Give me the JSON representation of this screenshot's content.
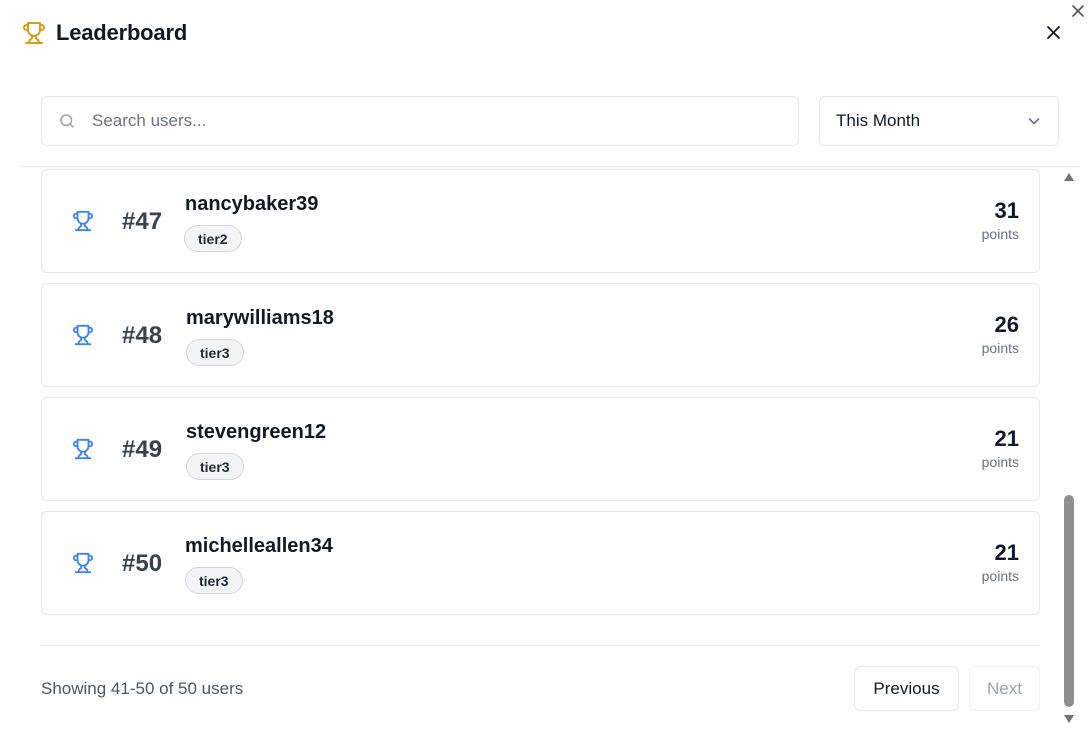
{
  "header": {
    "title": "Leaderboard"
  },
  "search": {
    "placeholder": "Search users..."
  },
  "period_select": {
    "value": "This Month"
  },
  "entries": [
    {
      "rank": "#47",
      "username": "nancybaker39",
      "tier": "tier2",
      "points": "31",
      "points_label": "points"
    },
    {
      "rank": "#48",
      "username": "marywilliams18",
      "tier": "tier3",
      "points": "26",
      "points_label": "points"
    },
    {
      "rank": "#49",
      "username": "stevengreen12",
      "tier": "tier3",
      "points": "21",
      "points_label": "points"
    },
    {
      "rank": "#50",
      "username": "michelleallen34",
      "tier": "tier3",
      "points": "21",
      "points_label": "points"
    }
  ],
  "pagination": {
    "summary": "Showing 41-50 of 50 users",
    "previous_label": "Previous",
    "next_label": "Next"
  },
  "colors": {
    "header_trophy": "#d4a017",
    "row_trophy": "#3b82f6",
    "border": "#e5e7eb"
  },
  "icons": {
    "header": "trophy-icon",
    "row": "trophy-icon",
    "search": "search-icon",
    "select": "chevron-down-icon",
    "close": "close-icon"
  }
}
